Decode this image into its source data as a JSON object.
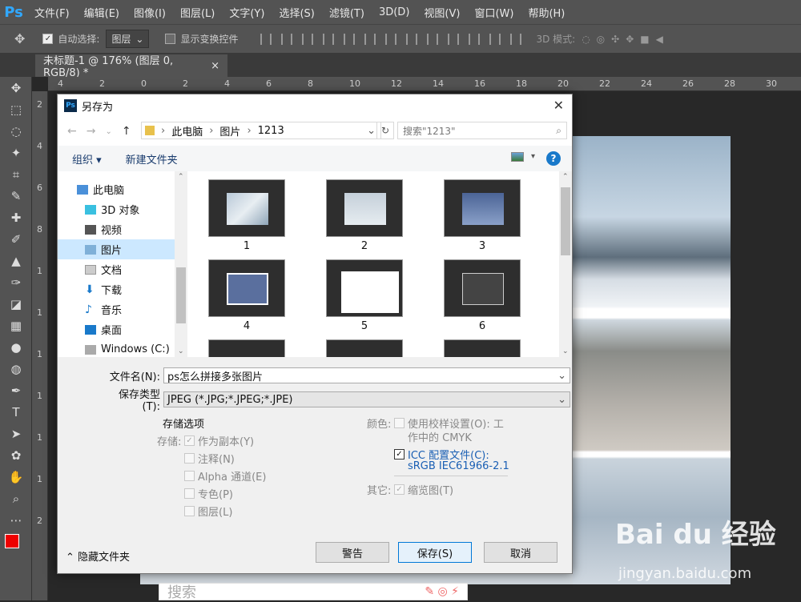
{
  "menubar": {
    "logo": "Ps",
    "items": [
      "文件(F)",
      "编辑(E)",
      "图像(I)",
      "图层(L)",
      "文字(Y)",
      "选择(S)",
      "滤镜(T)",
      "3D(D)",
      "视图(V)",
      "窗口(W)",
      "帮助(H)"
    ]
  },
  "options": {
    "auto_select_label": "自动选择:",
    "auto_select_value": "图层",
    "show_transform_label": "显示变换控件",
    "mode_3d": "3D 模式:"
  },
  "doc_tab": {
    "title": "未标题-1 @ 176% (图层 0, RGB/8) *",
    "close": "×"
  },
  "ruler": {
    "top": [
      "4",
      "2",
      "0",
      "2",
      "4",
      "6",
      "8",
      "10",
      "12",
      "14",
      "16",
      "18",
      "20",
      "22",
      "24",
      "26",
      "28",
      "30"
    ],
    "left": [
      "2",
      "4",
      "6",
      "8",
      "1",
      "1",
      "1",
      "1",
      "1",
      "1",
      "2"
    ]
  },
  "dialog": {
    "title": "另存为",
    "close": "✕",
    "address": [
      "此电脑",
      "图片",
      "1213"
    ],
    "search_placeholder": "搜索\"1213\"",
    "organize": "组织 ▾",
    "new_folder": "新建文件夹",
    "help": "?",
    "nav_items": [
      "此电脑",
      "3D 对象",
      "视频",
      "图片",
      "文档",
      "下载",
      "音乐",
      "桌面",
      "Windows (C:)"
    ],
    "nav_selected": 3,
    "thumbnails": [
      "1",
      "2",
      "3",
      "4",
      "5",
      "6"
    ],
    "filename_label": "文件名(N):",
    "filename_value": "ps怎么拼接多张图片",
    "filetype_label": "保存类型(T):",
    "filetype_value": "JPEG (*.JPG;*.JPEG;*.JPE)",
    "storage_options_title": "存储选项",
    "storage_label": "存储:",
    "storage_checks": [
      {
        "label": "作为副本(Y)",
        "checked": true
      },
      {
        "label": "注释(N)",
        "checked": false
      },
      {
        "label": "Alpha 通道(E)",
        "checked": false
      },
      {
        "label": "专色(P)",
        "checked": false
      },
      {
        "label": "图层(L)",
        "checked": false
      }
    ],
    "color_label": "颜色:",
    "color_check_1": "使用校样设置(O): 工作中的 CMYK",
    "color_check_1_line1": "使用校样设置(O): 工",
    "color_check_1_line2": "作中的 CMYK",
    "icc_line1": "ICC 配置文件(C):",
    "icc_line2": "sRGB IEC61966-2.1",
    "other_label": "其它:",
    "thumbnail_check": "缩览图(T)",
    "hide_folders": "隐藏文件夹",
    "buttons": {
      "warning": "警告",
      "save": "保存(S)",
      "cancel": "取消"
    }
  },
  "bottombar": {
    "search": "搜索"
  },
  "watermark": {
    "brand": "Bai du 经验",
    "url": "jingyan.baidu.com"
  }
}
